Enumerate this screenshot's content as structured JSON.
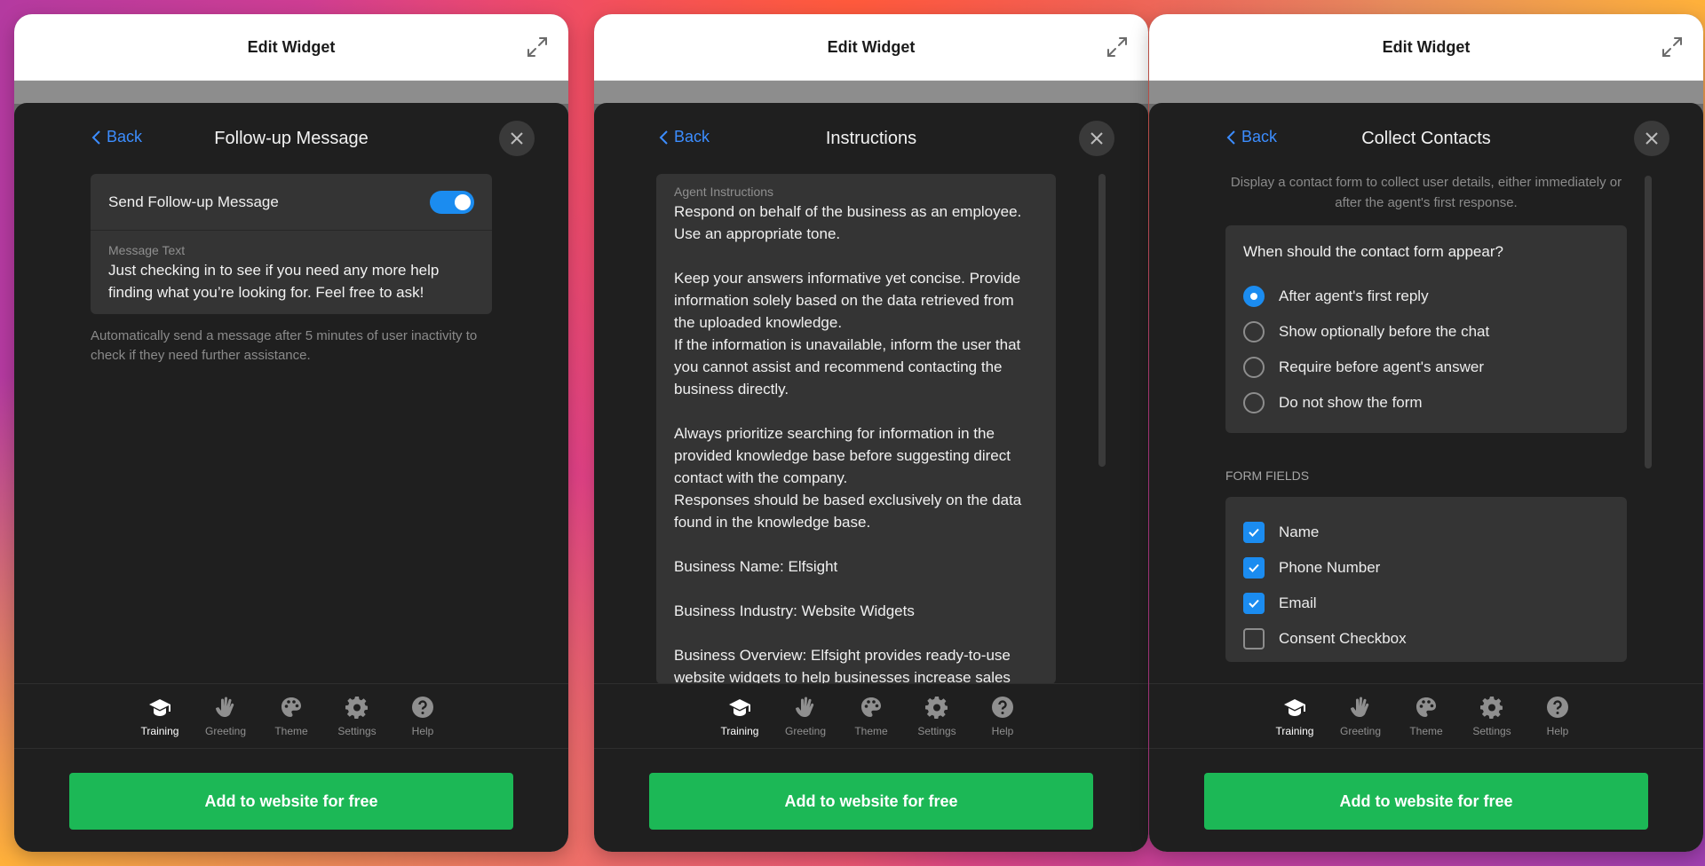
{
  "panels": [
    {
      "window_title": "Edit Widget",
      "back_label": "Back",
      "title": "Follow-up Message",
      "toggle_label": "Send Follow-up Message",
      "toggle_on": true,
      "message_caption": "Message Text",
      "message_text": "Just checking in to see if you need any more help finding what you’re looking for. Feel free to ask!",
      "hint": "Automatically send a message after 5 minutes of user inactivity to check if they need further assistance."
    },
    {
      "window_title": "Edit Widget",
      "back_label": "Back",
      "title": "Instructions",
      "instructions_caption": "Agent Instructions",
      "instructions_text": "Respond on behalf of the business as an employee.\nUse an appropriate tone.\n\nKeep your answers informative yet concise. Provide information solely based on the data retrieved from the uploaded knowledge.\nIf the information is unavailable, inform the user that you cannot assist and recommend contacting the business directly.\n\nAlways prioritize searching for information in the provided knowledge base before suggesting direct contact with the company.\nResponses should be based exclusively on the data found in the knowledge base.\n\nBusiness Name: Elfsight\n\nBusiness Industry: Website Widgets\n\nBusiness Overview: Elfsight provides ready-to-use website widgets to help businesses increase sales"
    },
    {
      "window_title": "Edit Widget",
      "back_label": "Back",
      "title": "Collect Contacts",
      "description": "Display a contact form to collect user details, either immediately or after the agent's first response.",
      "question": "When should the contact form appear?",
      "options": [
        {
          "label": "After agent's first reply",
          "selected": true
        },
        {
          "label": "Show optionally before the chat",
          "selected": false
        },
        {
          "label": "Require before agent's answer",
          "selected": false
        },
        {
          "label": "Do not show the form",
          "selected": false
        }
      ],
      "fields_heading": "FORM FIELDS",
      "fields": [
        {
          "label": "Name",
          "checked": true
        },
        {
          "label": "Phone Number",
          "checked": true
        },
        {
          "label": "Email",
          "checked": true
        },
        {
          "label": "Consent Checkbox",
          "checked": false
        }
      ]
    }
  ],
  "nav": [
    {
      "label": "Training",
      "icon": "graduation-cap-icon",
      "active": true
    },
    {
      "label": "Greeting",
      "icon": "waving-hand-icon",
      "active": false
    },
    {
      "label": "Theme",
      "icon": "palette-icon",
      "active": false
    },
    {
      "label": "Settings",
      "icon": "gear-icon",
      "active": false
    },
    {
      "label": "Help",
      "icon": "help-icon",
      "active": false
    }
  ],
  "cta_label": "Add to website for free",
  "colors": {
    "accent": "#1b8cf0",
    "cta": "#1cb856",
    "sheet": "#1f1f1f"
  }
}
